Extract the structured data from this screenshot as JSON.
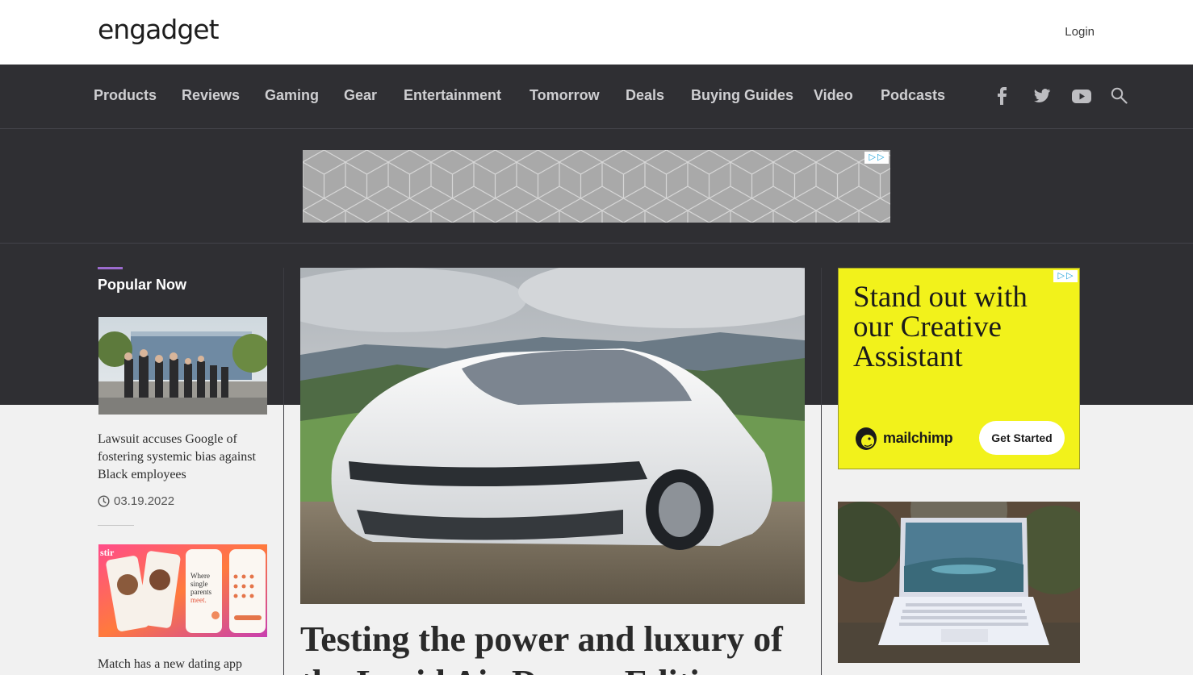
{
  "header": {
    "logo_text": "engadget",
    "login_label": "Login"
  },
  "nav": {
    "items": [
      {
        "label": "Products"
      },
      {
        "label": "Reviews"
      },
      {
        "label": "Gaming"
      },
      {
        "label": "Gear"
      },
      {
        "label": "Entertainment"
      },
      {
        "label": "Tomorrow"
      },
      {
        "label": "Deals"
      },
      {
        "label": "Buying Guides"
      },
      {
        "label": "Video"
      },
      {
        "label": "Podcasts"
      }
    ],
    "icons": [
      "facebook-icon",
      "twitter-icon",
      "youtube-icon",
      "search-icon"
    ]
  },
  "popular": {
    "heading": "Popular Now",
    "items": [
      {
        "headline": "Lawsuit accuses Google of fostering systemic bias against Black employees",
        "date": "03.19.2022"
      },
      {
        "headline": "Match has a new dating app"
      }
    ]
  },
  "hero": {
    "title": "Testing the power and luxury of the Lucid Air Dream Edition"
  },
  "ad_right": {
    "headline": "Stand out with our Creative Assistant",
    "brand": "mailchimp",
    "cta": "Get Started"
  },
  "colors": {
    "dark_band": "#2f2f33",
    "accent": "#9b6bce",
    "ad_yellow": "#f2f21b"
  }
}
